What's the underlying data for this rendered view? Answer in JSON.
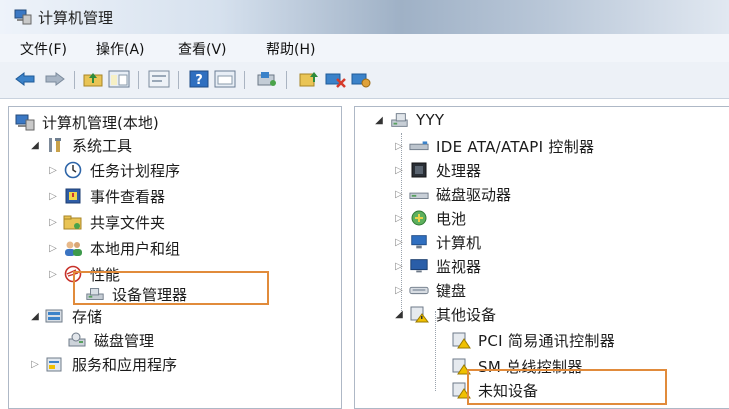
{
  "window": {
    "title": "计算机管理"
  },
  "menu": [
    "文件(F)",
    "操作(A)",
    "查看(V)",
    "帮助(H)"
  ],
  "left_tree": {
    "root": "计算机管理(本地)",
    "system_tools": "系统工具",
    "task_scheduler": "任务计划程序",
    "event_viewer": "事件查看器",
    "shared_folders": "共享文件夹",
    "local_users": "本地用户和组",
    "performance": "性能",
    "device_manager": "设备管理器",
    "storage": "存储",
    "disk_management": "磁盘管理",
    "services_apps": "服务和应用程序"
  },
  "right_tree": {
    "computer": "YYY",
    "ide": "IDE ATA/ATAPI 控制器",
    "processor": "处理器",
    "disk_drives": "磁盘驱动器",
    "battery": "电池",
    "computer_cat": "计算机",
    "monitors": "监视器",
    "keyboard": "键盘",
    "other_devices": "其他设备",
    "pci": "PCI 简易通讯控制器",
    "sm": "SM 总线控制器",
    "unknown": "未知设备"
  },
  "colors": {
    "highlight": "#e18b3b",
    "warning": "#f0c000"
  }
}
